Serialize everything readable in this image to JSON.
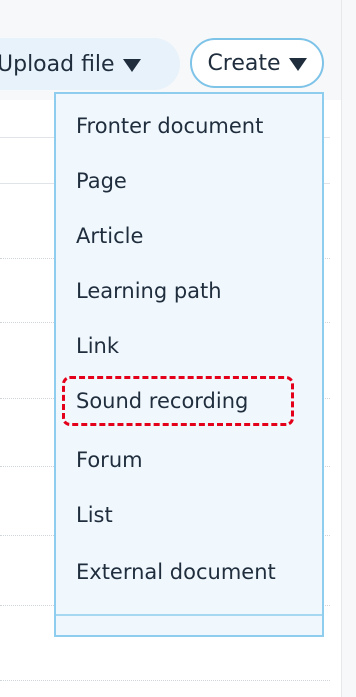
{
  "toolbar": {
    "upload_label": "Upload file",
    "create_label": "Create"
  },
  "dropdown": {
    "items": [
      {
        "label": "Fronter document"
      },
      {
        "label": "Page"
      },
      {
        "label": "Article"
      },
      {
        "label": "Learning path"
      },
      {
        "label": "Link"
      },
      {
        "label": "Sound recording",
        "highlighted": true
      },
      {
        "label": "Forum"
      },
      {
        "label": "List"
      },
      {
        "label": "External document"
      }
    ]
  },
  "colors": {
    "accent_border": "#7ec3e8",
    "menu_bg": "#f0f8fd",
    "highlight": "#e4001b"
  }
}
